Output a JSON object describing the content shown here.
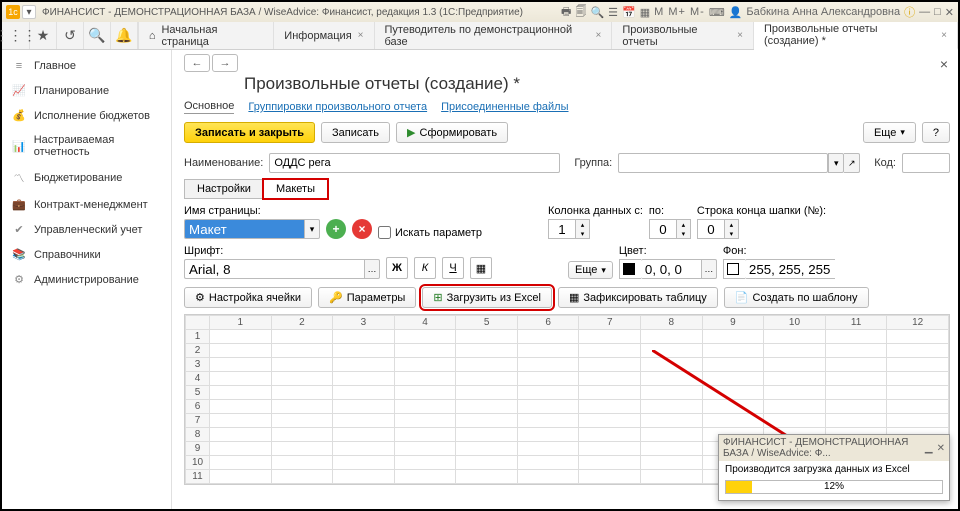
{
  "titlebar": {
    "title": "ФИНАНСИСТ - ДЕМОНСТРАЦИОННАЯ БАЗА / WiseAdvice: Финансист, редакция 1.3  (1С:Предприятие)",
    "user": "Бабкина Анна Александровна",
    "right_markers": "M  M+  M-"
  },
  "topnav": {
    "home": "Начальная страница",
    "tabs": [
      {
        "label": "Информация",
        "close": "×"
      },
      {
        "label": "Путеводитель по демонстрационной базе",
        "close": "×"
      },
      {
        "label": "Произвольные отчеты",
        "close": "×"
      },
      {
        "label": "Произвольные отчеты (создание) *",
        "close": "×",
        "active": true
      }
    ]
  },
  "sidebar": {
    "items": [
      {
        "label": "Главное"
      },
      {
        "label": "Планирование"
      },
      {
        "label": "Исполнение бюджетов"
      },
      {
        "label": "Настраиваемая отчетность"
      },
      {
        "label": "Бюджетирование"
      },
      {
        "label": "Контракт-менеджмент"
      },
      {
        "label": "Управленческий учет"
      },
      {
        "label": "Справочники"
      },
      {
        "label": "Администрирование"
      }
    ]
  },
  "page": {
    "title": "Произвольные отчеты (создание) *",
    "subnav": {
      "main": "Основное",
      "group": "Группировки произвольного отчета",
      "files": "Присоединенные файлы"
    },
    "toolbar": {
      "save_close": "Записать и закрыть",
      "save": "Записать",
      "form": "Сформировать",
      "more": "Еще",
      "help": "?"
    },
    "form": {
      "name_label": "Наименование:",
      "name_value": "ОДДС рега",
      "group_label": "Группа:",
      "group_value": "",
      "code_label": "Код:",
      "code_value": ""
    },
    "tabs": {
      "settings": "Настройки",
      "layouts": "Макеты"
    },
    "layout": {
      "page_name_label": "Имя страницы:",
      "page_name_value": "Макет",
      "search_param": "Искать параметр",
      "col_from_label": "Колонка данных с:",
      "po": "по:",
      "col_from": "1",
      "col_to": "0",
      "header_end_label": "Строка конца шапки (№):",
      "header_end": "0",
      "font_label": "Шрифт:",
      "font_value": "Arial, 8",
      "more": "Еще",
      "color_label": "Цвет:",
      "color_value": "0, 0, 0",
      "bg_label": "Фон:",
      "bg_value": "255, 255, 255 ...",
      "btns": {
        "cell": "Настройка ячейки",
        "params": "Параметры",
        "excel": "Загрузить из Excel",
        "fix": "Зафиксировать таблицу",
        "tmpl": "Создать по шаблону"
      }
    },
    "grid": {
      "cols": [
        "1",
        "2",
        "3",
        "4",
        "5",
        "6",
        "7",
        "8",
        "9",
        "10",
        "11",
        "12"
      ],
      "rows": [
        "1",
        "2",
        "3",
        "4",
        "5",
        "6",
        "7",
        "8",
        "9",
        "10",
        "11"
      ]
    }
  },
  "popup": {
    "title": "ФИНАНСИСТ - ДЕМОНСТРАЦИОННАЯ БАЗА / WiseAdvice: Ф...",
    "msg": "Производится загрузка данных из Excel",
    "pct": "12%",
    "pct_val": 12
  }
}
